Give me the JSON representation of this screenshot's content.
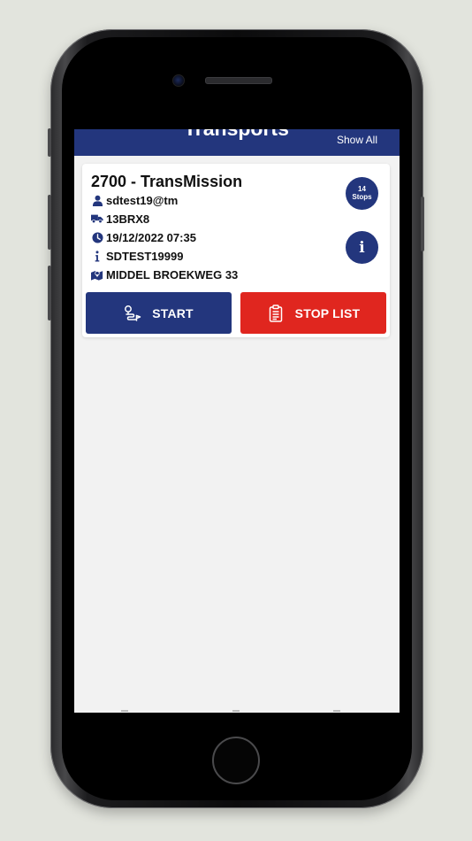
{
  "header": {
    "title": "Transports",
    "show_all": "Show All"
  },
  "card": {
    "title": "2700 - TransMission",
    "user": "sdtest19@tm",
    "vehicle": "13BRX8",
    "datetime": "19/12/2022 07:35",
    "reference": "SDTEST19999",
    "address": "MIDDEL BROEKWEG 33",
    "stops_count": "14",
    "stops_label": "Stops",
    "info_label": "i",
    "start_label": "START",
    "stop_list_label": "STOP LIST"
  },
  "colors": {
    "primary": "#23367d",
    "danger": "#e0261f",
    "background": "#f2f2f2"
  },
  "icons": {
    "user": "person-icon",
    "vehicle": "truck-icon",
    "datetime": "clock-icon",
    "reference": "info-icon",
    "address": "map-icon",
    "start": "route-icon",
    "stop_list": "clipboard-icon"
  }
}
